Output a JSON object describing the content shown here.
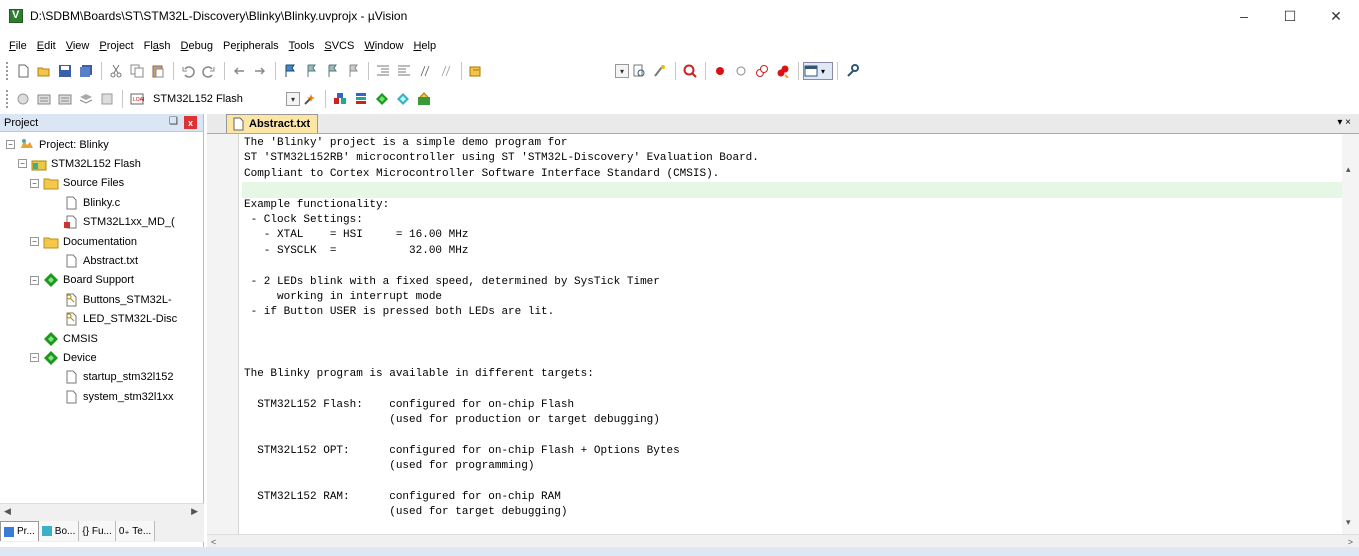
{
  "window": {
    "title": "D:\\SDBM\\Boards\\ST\\STM32L-Discovery\\Blinky\\Blinky.uvprojx - µVision",
    "minimize": "–",
    "maximize": "☐",
    "close": "✕"
  },
  "menu": [
    {
      "label": "File",
      "ul": "F",
      "rest": "ile"
    },
    {
      "label": "Edit",
      "ul": "E",
      "rest": "dit"
    },
    {
      "label": "View",
      "ul": "V",
      "rest": "iew"
    },
    {
      "label": "Project",
      "ul": "P",
      "rest": "roject"
    },
    {
      "label": "Flash",
      "pre": "Fl",
      "ul": "a",
      "rest": "sh"
    },
    {
      "label": "Debug",
      "ul": "D",
      "rest": "ebug"
    },
    {
      "label": "Peripherals",
      "pre": "Pe",
      "ul": "r",
      "rest": "ipherals"
    },
    {
      "label": "Tools",
      "ul": "T",
      "rest": "ools"
    },
    {
      "label": "SVCS",
      "ul": "S",
      "rest": "VCS"
    },
    {
      "label": "Window",
      "ul": "W",
      "rest": "indow"
    },
    {
      "label": "Help",
      "ul": "H",
      "rest": "elp"
    }
  ],
  "toolbar2": {
    "target": "STM32L152 Flash"
  },
  "project_panel": {
    "title": "Project",
    "pin": "❑",
    "close": "x",
    "tree": [
      {
        "label": "Project: Blinky",
        "level": 0,
        "expander": "−",
        "icon": "project-icon"
      },
      {
        "label": "STM32L152 Flash",
        "level": 1,
        "expander": "−",
        "icon": "target-icon"
      },
      {
        "label": "Source Files",
        "level": 2,
        "expander": "−",
        "icon": "folder-icon"
      },
      {
        "label": "Blinky.c",
        "level": 3,
        "icon": "file-icon"
      },
      {
        "label": "STM32L1xx_MD_(",
        "level": 3,
        "icon": "ini-file-icon"
      },
      {
        "label": "Documentation",
        "level": 2,
        "expander": "−",
        "icon": "folder-icon"
      },
      {
        "label": "Abstract.txt",
        "level": 3,
        "icon": "file-icon"
      },
      {
        "label": "Board Support",
        "level": 2,
        "expander": "−",
        "icon": "component-icon"
      },
      {
        "label": "Buttons_STM32L-",
        "level": 3,
        "icon": "key-file-icon"
      },
      {
        "label": "LED_STM32L-Disc",
        "level": 3,
        "icon": "key-file-icon"
      },
      {
        "label": "CMSIS",
        "level": 2,
        "icon": "component-icon"
      },
      {
        "label": "Device",
        "level": 2,
        "expander": "−",
        "icon": "component-icon"
      },
      {
        "label": "startup_stm32l152",
        "level": 3,
        "icon": "file-icon"
      },
      {
        "label": "system_stm32l1xx",
        "level": 3,
        "icon": "file-icon"
      }
    ],
    "bottom_tabs": [
      "Pr...",
      "Bo...",
      "{} Fu...",
      "0₊ Te..."
    ]
  },
  "editor": {
    "tab_label": "Abstract.txt",
    "lines": [
      "The 'Blinky' project is a simple demo program for",
      "ST 'STM32L152RB' microcontroller using ST 'STM32L-Discovery' Evaluation Board.",
      "Compliant to Cortex Microcontroller Software Interface Standard (CMSIS).",
      "",
      "Example functionality:",
      " - Clock Settings:",
      "   - XTAL    = HSI     = 16.00 MHz",
      "   - SYSCLK  =           32.00 MHz",
      "",
      " - 2 LEDs blink with a fixed speed, determined by SysTick Timer",
      "     working in interrupt mode",
      " - if Button USER is pressed both LEDs are lit.",
      "",
      "",
      "",
      "The Blinky program is available in different targets:",
      "",
      "  STM32L152 Flash:    configured for on-chip Flash",
      "                      (used for production or target debugging)",
      "",
      "  STM32L152 OPT:      configured for on-chip Flash + Options Bytes",
      "                      (used for programming)",
      "",
      "  STM32L152 RAM:      configured for on-chip RAM",
      "                      (used for target debugging)"
    ],
    "highlighted_line": 3
  }
}
